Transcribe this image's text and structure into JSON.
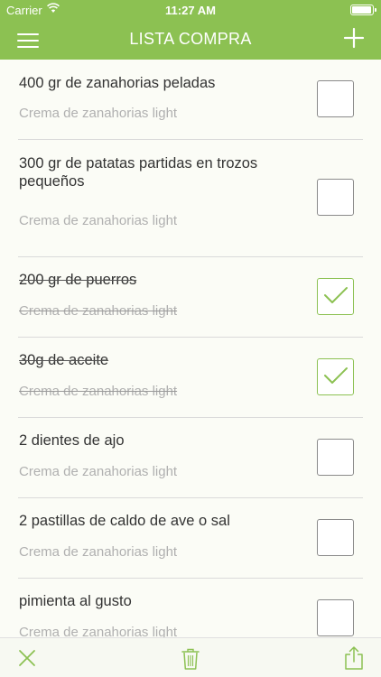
{
  "status": {
    "carrier": "Carrier",
    "time": "11:27 AM"
  },
  "nav": {
    "title": "LISTA COMPRA"
  },
  "items": [
    {
      "name": "400 gr de zanahorias peladas",
      "recipe": "Crema de zanahorias light",
      "checked": false
    },
    {
      "name": "300 gr de patatas partidas en trozos pequeños",
      "recipe": "Crema de zanahorias light",
      "checked": false
    },
    {
      "name": "200 gr de puerros",
      "recipe": "Crema de zanahorias light",
      "checked": true
    },
    {
      "name": "30g de aceite",
      "recipe": "Crema de zanahorias light",
      "checked": true
    },
    {
      "name": "2 dientes de ajo",
      "recipe": "Crema de zanahorias light",
      "checked": false
    },
    {
      "name": "2 pastillas de caldo de ave o sal",
      "recipe": "Crema de zanahorias light",
      "checked": false
    },
    {
      "name": "pimienta al gusto",
      "recipe": "Crema de zanahorias light",
      "checked": false
    }
  ],
  "colors": {
    "accent": "#8cc152",
    "toolbar_icon": "#8cc152"
  },
  "icons": {
    "menu": "hamburger-menu-icon",
    "add": "plus-icon",
    "clear": "close-x-icon",
    "delete": "trash-icon",
    "share": "share-icon"
  }
}
